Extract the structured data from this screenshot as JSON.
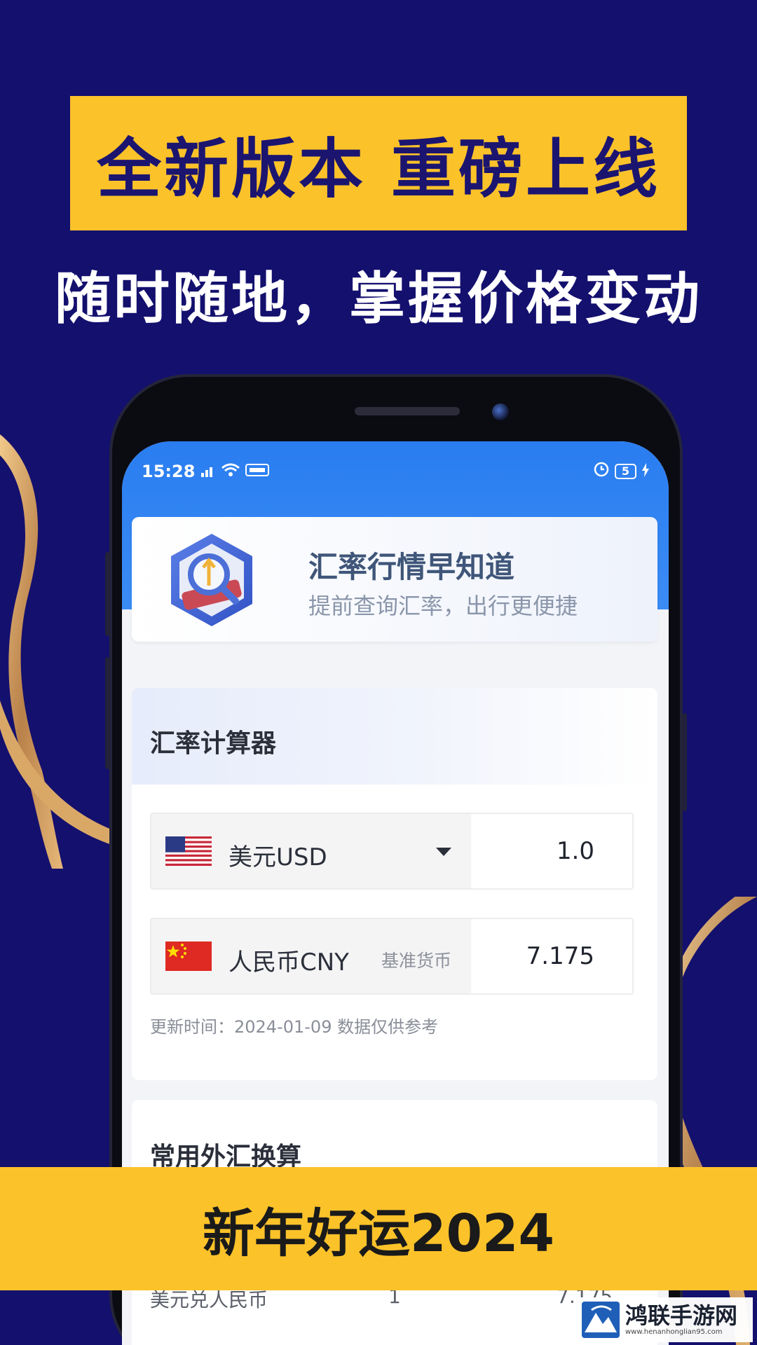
{
  "poster": {
    "headline": "全新版本 重磅上线",
    "subhead": "随时随地，掌握价格变动",
    "bottom_text": "新年好运2024"
  },
  "status_bar": {
    "time": "15:28",
    "battery": "5"
  },
  "banner": {
    "title": "汇率行情早知道",
    "subtitle": "提前查询汇率，出行更便捷"
  },
  "calculator": {
    "title": "汇率计算器",
    "from_currency": {
      "name": "美元USD",
      "value": "1.0",
      "flag": "us-flag-icon"
    },
    "to_currency": {
      "name": "人民币CNY",
      "tag": "基准货币",
      "value": "7.175",
      "flag": "cn-flag-icon"
    },
    "update_note": "更新时间：2024-01-09 数据仅供参考"
  },
  "fx_section": {
    "title": "常用外汇换算",
    "partial_row": {
      "pair": "美元兑人民币",
      "amount": "1",
      "rate": "7.175"
    }
  },
  "watermark": {
    "title": "鸿联手游网",
    "url": "www.henanhonglian95.com"
  },
  "colors": {
    "background": "#14106e",
    "accent_yellow": "#fcc22a",
    "app_blue": "#2a7df0"
  }
}
